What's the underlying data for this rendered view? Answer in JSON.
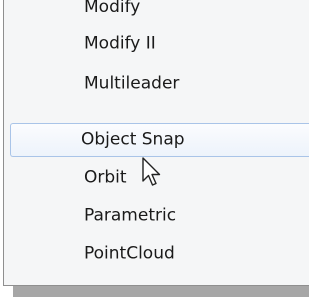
{
  "menu": {
    "items": [
      {
        "label": "Modify"
      },
      {
        "label": "Modify II"
      },
      {
        "label": "Multileader"
      },
      {
        "label": "Object Snap"
      },
      {
        "label": "Orbit"
      },
      {
        "label": "Parametric"
      },
      {
        "label": "PointCloud"
      }
    ],
    "highlighted_item": "Object Snap"
  },
  "cursor": {
    "icon": "arrow-pointer-icon"
  },
  "colors": {
    "highlight_border": "#a9c4e8",
    "highlight_fill": "#edf3fb",
    "menu_background": "#f5f6f7",
    "shadow": "#a6a6a6"
  }
}
